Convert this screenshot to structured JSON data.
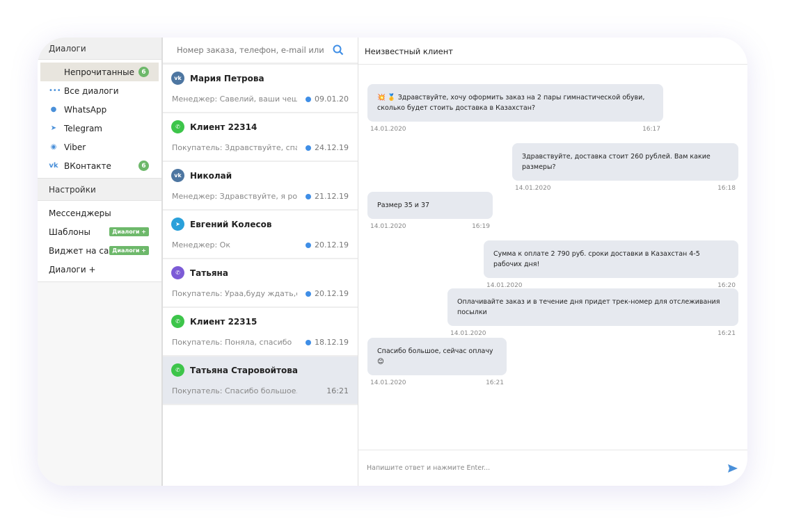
{
  "sidebar": {
    "dialogs_header": "Диалоги",
    "items": [
      {
        "label": "Непрочитанные",
        "badge": "6"
      },
      {
        "label": "Все диалоги",
        "icon": "dots-icon"
      },
      {
        "label": "WhatsApp",
        "icon": "whatsapp-icon"
      },
      {
        "label": "Telegram",
        "icon": "telegram-icon"
      },
      {
        "label": "Viber",
        "icon": "viber-icon"
      },
      {
        "label": "ВКонтакте",
        "icon": "vk-icon",
        "badge": "6"
      }
    ],
    "settings_header": "Настройки",
    "settings": [
      {
        "label": "Мессенджеры"
      },
      {
        "label": "Шаблоны",
        "tag": "Диалоги +"
      },
      {
        "label": "Виджет на сайт",
        "tag": "Диалоги +"
      },
      {
        "label": "Диалоги +"
      }
    ]
  },
  "search": {
    "placeholder": "Номер заказа, телефон, e-mail или"
  },
  "conversations": [
    {
      "name": "Мария Петрова",
      "channel": "vk",
      "preview": "Менеджер: Савелий, ваши чеш...",
      "date": "09.01.20"
    },
    {
      "name": "Клиент 22314",
      "channel": "whatsapp",
      "preview": "Покупатель: Здравствуйте, спа...",
      "date": "24.12.19"
    },
    {
      "name": "Николай",
      "channel": "vk",
      "preview": "Менеджер: Здравствуйте, я ро...",
      "date": "21.12.19"
    },
    {
      "name": "Евгений Колесов",
      "channel": "telegram",
      "preview": "Менеджер: Ок",
      "date": "20.12.19"
    },
    {
      "name": "Татьяна",
      "channel": "viber",
      "preview": "Покупатель: Ураа,буду ждать,с...",
      "date": "20.12.19"
    },
    {
      "name": "Клиент 22315",
      "channel": "whatsapp",
      "preview": "Покупатель: Поняла, спасибо",
      "date": "18.12.19"
    },
    {
      "name": "Татьяна Старовойтова",
      "channel": "whatsapp",
      "preview": "Покупатель: Спасибо большое...",
      "date": "16:21"
    }
  ],
  "chat": {
    "title": "Неизвестный клиент",
    "input_placeholder": "Напишите ответ и нажмите Enter...",
    "messages": [
      {
        "text": "💥 🥇 Здравствуйте, хочу оформить заказ на 2 пары гимнастической обуви, сколько будет стоить доставка в Казахстан?",
        "date": "14.01.2020",
        "time": "16:17",
        "side": "in"
      },
      {
        "text": "Здравствуйте, доставка стоит 260 рублей. Вам какие размеры?",
        "date": "14.01.2020",
        "time": "16:18",
        "side": "out"
      },
      {
        "text": "Размер 35 и 37",
        "date": "14.01.2020",
        "time": "16:19",
        "side": "in"
      },
      {
        "text": "Сумма к оплате 2 790 руб. сроки доставки в Казахстан 4-5 рабочих дня!",
        "date": "14.01.2020",
        "time": "16:20",
        "side": "out"
      },
      {
        "text": "Оплачивайте заказ и в течение дня придет трек-номер для отслеживания посылки",
        "date": "14.01.2020",
        "time": "16:21",
        "side": "out"
      },
      {
        "text": "Спасибо большое, сейчас оплачу 😊",
        "date": "14.01.2020",
        "time": "16:21",
        "side": "in"
      }
    ]
  }
}
